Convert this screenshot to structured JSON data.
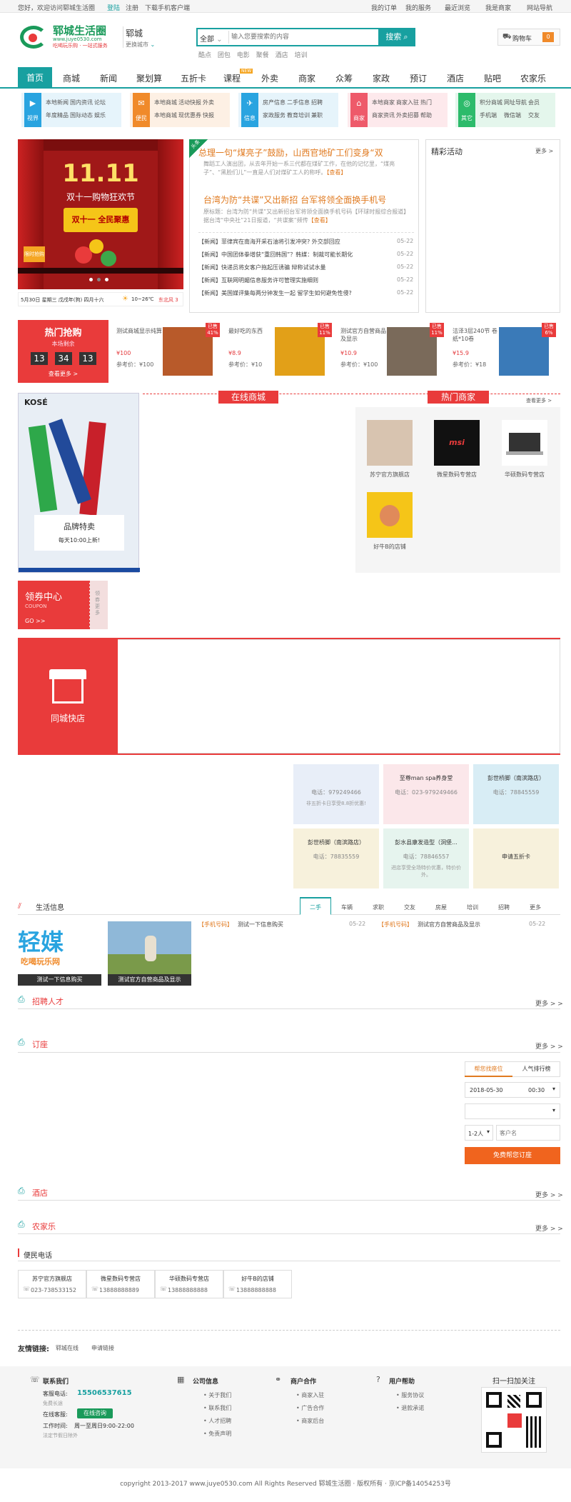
{
  "topbar": {
    "welcome": "您好，欢迎访问郓城生活圈",
    "login": "登陆",
    "register": "注册",
    "download": "下载手机客户端",
    "links": [
      "我的订单",
      "我的服务",
      "最近浏览",
      "我是商家",
      "网站导航"
    ]
  },
  "header": {
    "logo_main": "郓城生活圈",
    "logo_url": "www.juye0530.com",
    "logo_slogan": "吃喝玩乐购 · 一站式服务",
    "city": "郓城",
    "switch_city": "更换城市",
    "search_category": "全部",
    "search_placeholder": "输入您要搜索的内容",
    "search_button": "搜索",
    "search_tags": [
      "酷点",
      "团包",
      "电影",
      "聚餐",
      "酒店",
      "培训"
    ],
    "cart_label": "购物车",
    "cart_count": "0"
  },
  "nav": {
    "home": "首页",
    "items": [
      "商城",
      "新闻",
      "聚划算",
      "五折卡",
      "课程",
      "外卖",
      "商家",
      "众筹",
      "家政",
      "预订",
      "酒店",
      "贴吧",
      "农家乐"
    ],
    "new_badge": "NEW"
  },
  "categories": [
    {
      "name": "视界",
      "color": "#29a4e0",
      "bg": "#e6f4fb",
      "links": [
        "本地新闻",
        "国内资讯",
        "论坛",
        "年度精品",
        "国际动态",
        "娱乐"
      ]
    },
    {
      "name": "便民",
      "color": "#f08a2a",
      "bg": "#fdf0e4",
      "links": [
        "本地商城",
        "活动快报",
        "外卖",
        "本地商城",
        "现优惠券",
        "快报"
      ]
    },
    {
      "name": "信息",
      "color": "#29a4e0",
      "bg": "#e6f4fb",
      "links": [
        "房产信息",
        "二手信息",
        "招聘",
        "家政服务",
        "教育培训",
        "兼职"
      ]
    },
    {
      "name": "商家",
      "color": "#ee5a6a",
      "bg": "#fde9ec",
      "links": [
        "本地商家",
        "商家入驻",
        "热门",
        "商家资讯",
        "外卖招募",
        "帮助"
      ]
    },
    {
      "name": "其它",
      "color": "#2dbb6b",
      "bg": "#e4f6ec",
      "links": [
        "积分商城",
        "网址导航",
        "会员",
        "手机端",
        "微信端",
        "交友"
      ]
    }
  ],
  "banner": {
    "title": "11.11",
    "subtitle": "双十一购物狂欢节",
    "badge": "双十一 全民聚惠",
    "tag": "限时抢购",
    "footer_date": "5月30日 星期三 戊戌年(狗) 四月十六",
    "weather": "10~26℃",
    "wind": "东北风 3"
  },
  "news": {
    "headline_tag": "头条",
    "headline1": "总理一句“煤亮子”鼓励，山西官地矿工们变身“双",
    "headline1_desc": "舞蹈工人演出团，从去年开始一系三代都在煤矿工作，在他的记忆里，“煤亮子”、“黑脸们儿”一直是人们对煤矿工人的称呼。",
    "headline1_more": "【查看】",
    "headline2": "台湾为防“共谍”又出新招 台军将领全面换手机号",
    "headline2_desc": "原标题：台湾为防“共谍”又出新招台军将领全面换手机号码【环球时报综合报道】据台湾“中央社”21日报道，“共谍案”频传",
    "headline2_more": "【查看】",
    "items": [
      {
        "text": "【新闻】菲律宾在南海开采石油将引发冲突? 外交部回应",
        "date": "05-22"
      },
      {
        "text": "【新闻】中国团体拳增获“重回韩国”？韩媒：制裁可能长期化",
        "date": "05-22"
      },
      {
        "text": "【新闻】快递员将女客户拖起压诱骗 辩称试试水量",
        "date": "05-22"
      },
      {
        "text": "【新闻】互联网明媚信息服务许可管理实施细则",
        "date": "05-22"
      },
      {
        "text": "【新闻】美国媒评集每两分钟发生一起 留学生如何避免性侵?",
        "date": "05-22"
      }
    ]
  },
  "events": {
    "title": "精彩活动",
    "more": "更多 >"
  },
  "flash_sale": {
    "title": "热门抢购",
    "subtitle": "本场剩余",
    "hours": "13",
    "minutes": "34",
    "seconds": "13",
    "more": "查看更多 >",
    "items": [
      {
        "name": "测试商城显示纯算",
        "price": "¥100",
        "ref": "参考价：¥100",
        "tag": "已售41%"
      },
      {
        "name": "最好吃的东西",
        "price": "¥8.9",
        "ref": "参考价：¥10",
        "tag": "已售11%"
      },
      {
        "name": "测试官方自营商品及显示",
        "price": "¥10.9",
        "ref": "参考价：¥100",
        "tag": "已售11%"
      },
      {
        "name": "洁泽3层240节 卷纸*10卷",
        "price": "¥15.9",
        "ref": "参考价：¥18",
        "tag": "已售6%"
      }
    ]
  },
  "mall": {
    "brand": "KOSÉ",
    "brand_title": "品牌特卖",
    "brand_desc": "每天10:00上新!",
    "online_title": "在线商城",
    "hot_title": "热门商家",
    "hot_more": "查看更多 >",
    "hot_shops": [
      "苏宁官方旗舰店",
      "微星数码专营店",
      "华硕数码专营店",
      "好牛B的店铺"
    ]
  },
  "coupon": {
    "title": "领券中心",
    "sub": "COUPON",
    "go": "GO >>",
    "side": "领券更多"
  },
  "local_shop": {
    "title": "同城快店",
    "cards": [
      {
        "name": "",
        "phone": "电话：979249466",
        "note": "非五折卡日享受8.8折优惠!",
        "bg": "#e8eef8"
      },
      {
        "name": "至尊man spa养身堂",
        "phone": "电话：023-979249466",
        "note": "",
        "bg": "#fbe7ea"
      },
      {
        "name": "彭世桥脚（南滨路店）",
        "phone": "电话：78845559",
        "note": "",
        "bg": "#d8edf5"
      },
      {
        "name": "彭世桥脚（南滨路店）",
        "phone": "电话：78835559",
        "note": "",
        "bg": "#f7f1dc"
      },
      {
        "name": "彭水县康发造型（洞堡...",
        "phone": "电话：78846557",
        "note": "进店享受全场特价优惠，特价价外。",
        "bg": "#e6f4ee"
      },
      {
        "name": "申请五折卡",
        "phone": "",
        "note": "",
        "bg": "#f7f1dc"
      }
    ]
  },
  "life": {
    "title": "生活信息",
    "tabs": [
      "二手",
      "车辆",
      "求职",
      "交友",
      "房屋",
      "培训",
      "招聘",
      "更多"
    ],
    "img_caption1": "测试一下信息购买",
    "img_caption2": "测试官方自营商品及显示",
    "logo_text": "轻媒",
    "logo_sub": "吃喝玩乐网",
    "list": [
      {
        "tag": "【手机号码】",
        "text": "测试一下信息购买",
        "date": "05-22"
      },
      {
        "tag": "【手机号码】",
        "text": "测试官方自营商品及显示",
        "date": "05-22"
      }
    ]
  },
  "jobs": {
    "title": "招聘人才",
    "more": "更多 > >"
  },
  "booking": {
    "title": "订座",
    "more": "更多 > >",
    "tab1": "帮您找座位",
    "tab2": "人气排行榜",
    "date": "2018-05-30",
    "time": "00:30",
    "people": "1-2人",
    "name_placeholder": "客户名",
    "submit": "免费帮您订座"
  },
  "hotel": {
    "title": "酒店",
    "more": "更多 > >"
  },
  "farm": {
    "title": "农家乐",
    "more": "更多 > >"
  },
  "phones": {
    "title": "便民电话",
    "items": [
      {
        "name": "苏宁官方旗舰店",
        "phone": "023-738533152"
      },
      {
        "name": "微星数码专营店",
        "phone": "13888888889"
      },
      {
        "name": "华硕数码专营店",
        "phone": "13888888888"
      },
      {
        "name": "好牛B的店铺",
        "phone": "13888888888"
      }
    ]
  },
  "friend_links": {
    "title": "友情链接:",
    "items": [
      "郓城在线",
      "申请链接"
    ]
  },
  "footer": {
    "contact_title": "联系我们",
    "hotline_label": "客服电话:",
    "hotline": "15506537615",
    "hotline_note": "免费长途",
    "online_label": "在线客服:",
    "online_btn": "在线咨询",
    "hours_label": "工作时间:",
    "hours": "周一至周日9:00-22:00",
    "holiday": "法定节假日除外",
    "company_title": "公司信息",
    "company_links": [
      "关于我们",
      "联系我们",
      "人才招聘",
      "免责声明"
    ],
    "partner_title": "商户合作",
    "partner_links": [
      "商家入驻",
      "广告合作",
      "商家后台"
    ],
    "help_title": "用户帮助",
    "help_links": [
      "服务协议",
      "退款承诺"
    ],
    "qr_title": "扫一扫加关注",
    "copyright": "copyright 2013-2017 www.juye0530.com All Rights Reserved 郓城生活圈 · 版权所有 · 京ICP备14054253号"
  }
}
